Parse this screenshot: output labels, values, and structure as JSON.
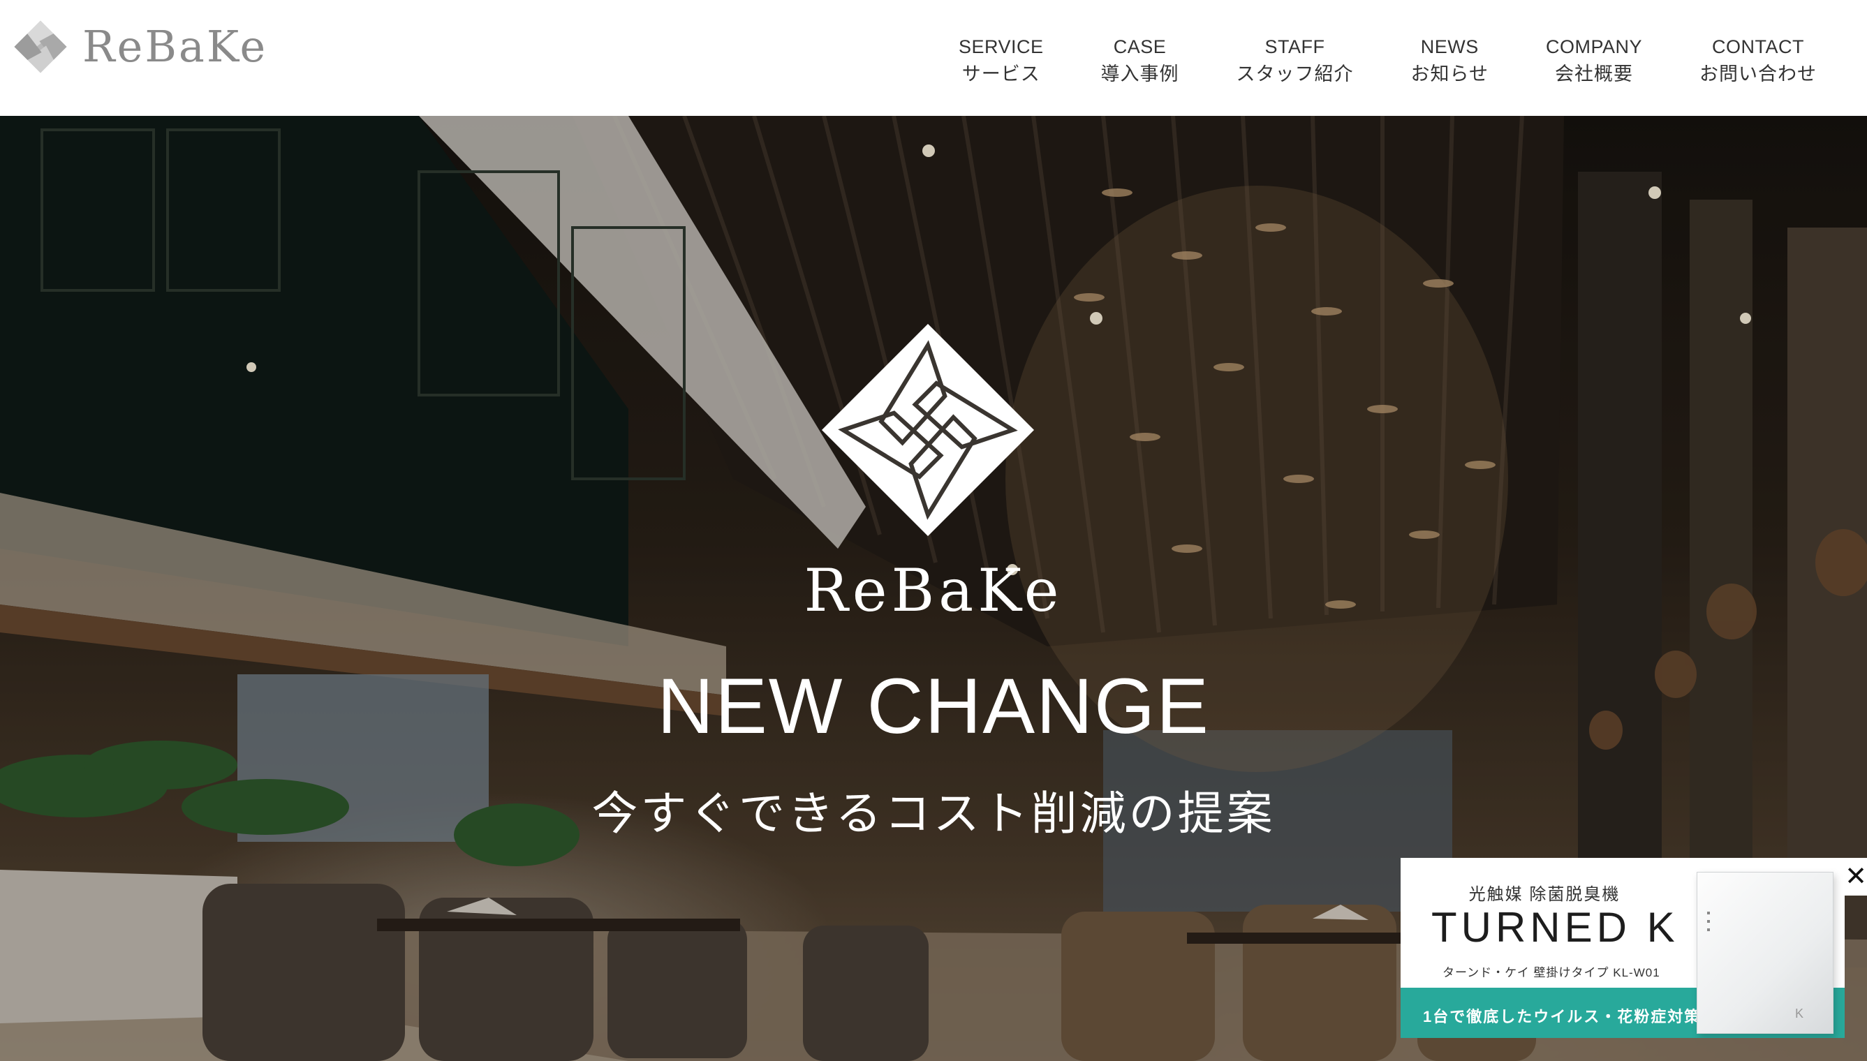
{
  "header": {
    "logo_text": "ReBaKe",
    "nav": [
      {
        "en": "SERVICE",
        "jp": "サービス"
      },
      {
        "en": "CASE",
        "jp": "導入事例"
      },
      {
        "en": "STAFF",
        "jp": "スタッフ紹介"
      },
      {
        "en": "NEWS",
        "jp": "お知らせ"
      },
      {
        "en": "COMPANY",
        "jp": "会社概要"
      },
      {
        "en": "CONTACT",
        "jp": "お問い合わせ"
      }
    ]
  },
  "hero": {
    "brand": "ReBaKe",
    "title": "NEW CHANGE",
    "subtitle": "今すぐできるコスト削減の提案"
  },
  "ad": {
    "tagline": "光触媒 除菌脱臭機",
    "product_logo": "TURNED K",
    "model": "ターンド・ケイ 壁掛けタイプ KL-W01",
    "strip_text": "1台で徹底したウイルス・花粉症対策",
    "close_glyph": "✕",
    "accent_color": "#28a99b"
  },
  "icons": {
    "logo": "rebake-diamond-icon",
    "close": "close-icon"
  }
}
